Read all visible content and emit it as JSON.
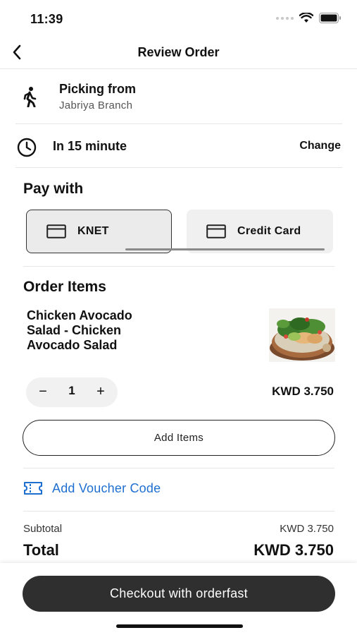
{
  "status_bar": {
    "time": "11:39"
  },
  "nav": {
    "title": "Review Order",
    "back_icon": "chevron-left-icon"
  },
  "pickup": {
    "title": "Picking from",
    "branch": "Jabriya Branch",
    "icon": "walking-person-icon"
  },
  "timing": {
    "label": "In 15 minute",
    "change_label": "Change",
    "icon": "clock-icon"
  },
  "payment": {
    "title": "Pay with",
    "options": [
      {
        "label": "KNET",
        "icon": "card-icon",
        "selected": true
      },
      {
        "label": "Credit Card",
        "icon": "card-icon",
        "selected": false
      }
    ]
  },
  "order_items": {
    "title": "Order Items",
    "items": [
      {
        "name": "Chicken Avocado Salad - Chicken Avocado Salad",
        "quantity": "1",
        "price": "KWD 3.750"
      }
    ],
    "add_items_label": "Add Items"
  },
  "voucher": {
    "label": "Add Voucher Code",
    "icon": "ticket-icon",
    "color": "#1f6fd1"
  },
  "summary": {
    "subtotal_label": "Subtotal",
    "subtotal_value": "KWD 3.750",
    "total_label": "Total",
    "total_value": "KWD 3.750"
  },
  "checkout": {
    "label": "Checkout with orderfast",
    "color": "#2f2f2f"
  }
}
